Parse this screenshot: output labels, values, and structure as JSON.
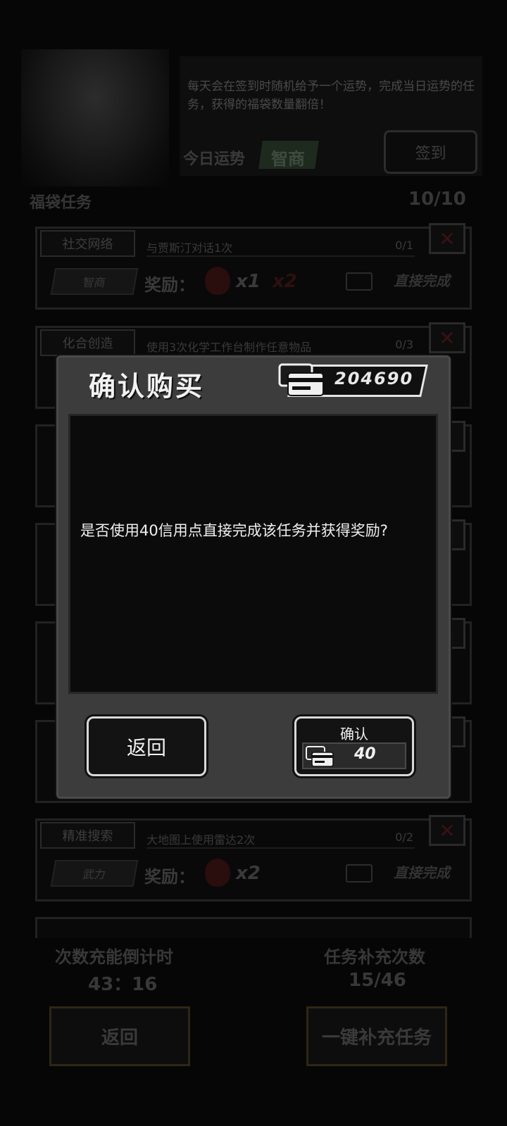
{
  "header": {
    "intro_text": "每天会在签到时随机给予一个运势，完成当日运势的任务，获得的福袋数量翻倍！",
    "fortune_label": "今日运势",
    "fortune_value": "智商",
    "signin_label": "签到"
  },
  "tasks_section": {
    "title": "福袋任务",
    "count": "10/10"
  },
  "tasks": [
    {
      "tag": "社交网络",
      "desc": "与贾斯汀对话1次",
      "progress": "0/1",
      "badge": "智商",
      "reward_label": "奖励：",
      "mult": "x1",
      "mult2": "x2",
      "complete": "直接完成"
    },
    {
      "tag": "化合创造",
      "desc": "使用3次化学工作台制作任意物品",
      "progress": "0/3"
    },
    {
      "tag": "精准搜索",
      "desc": "大地图上使用雷达2次",
      "progress": "0/2",
      "badge": "武力",
      "reward_label": "奖励：",
      "mult": "x2",
      "complete": "直接完成"
    }
  ],
  "bottom": {
    "timer_label": "次数充能倒计时",
    "timer_value": "43：16",
    "refill_label": "任务补充次数",
    "refill_value": "15/46",
    "back_label": "返回",
    "refill_button_label": "一键补充任务"
  },
  "modal": {
    "title": "确认购买",
    "balance": "204690",
    "message": "是否使用40信用点直接完成该任务并获得奖励?",
    "back_label": "返回",
    "confirm_label": "确认",
    "cost": "40",
    "icon": "credit-card-icon"
  }
}
